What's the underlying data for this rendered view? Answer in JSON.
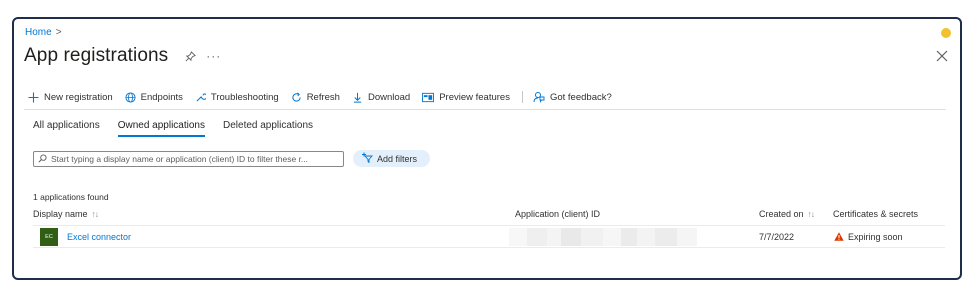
{
  "breadcrumb": {
    "home": "Home",
    "separator": ">"
  },
  "page": {
    "title": "App registrations",
    "more": "···"
  },
  "toolbar": {
    "new_registration": "New registration",
    "endpoints": "Endpoints",
    "troubleshooting": "Troubleshooting",
    "refresh": "Refresh",
    "download": "Download",
    "preview_features": "Preview features",
    "got_feedback": "Got feedback?"
  },
  "tabs": [
    {
      "label": "All applications",
      "active": false
    },
    {
      "label": "Owned applications",
      "active": true
    },
    {
      "label": "Deleted applications",
      "active": false
    }
  ],
  "search": {
    "placeholder": "Start typing a display name or application (client) ID to filter these r..."
  },
  "filters": {
    "add_label": "Add filters"
  },
  "results": {
    "count_text": "1 applications found"
  },
  "table": {
    "columns": {
      "display_name": "Display name",
      "client_id": "Application (client) ID",
      "created_on": "Created on",
      "certs": "Certificates & secrets"
    },
    "sort_glyph": "↑↓",
    "rows": [
      {
        "initials": "EC",
        "name": "Excel connector",
        "client_id_redacted": true,
        "created_on": "7/7/2022",
        "cert_status": "Expiring soon"
      }
    ]
  },
  "colors": {
    "accent": "#0078d4",
    "warning": "#d83b01",
    "avatar": "#2f5e14",
    "status_dot": "#f2c12e",
    "frame": "#1f2d4a"
  },
  "icons": {
    "new_registration": "plus-icon",
    "endpoints": "globe-icon",
    "troubleshooting": "wrench-icon",
    "refresh": "refresh-icon",
    "download": "download-icon",
    "preview_features": "preview-icon",
    "got_feedback": "feedback-icon"
  }
}
